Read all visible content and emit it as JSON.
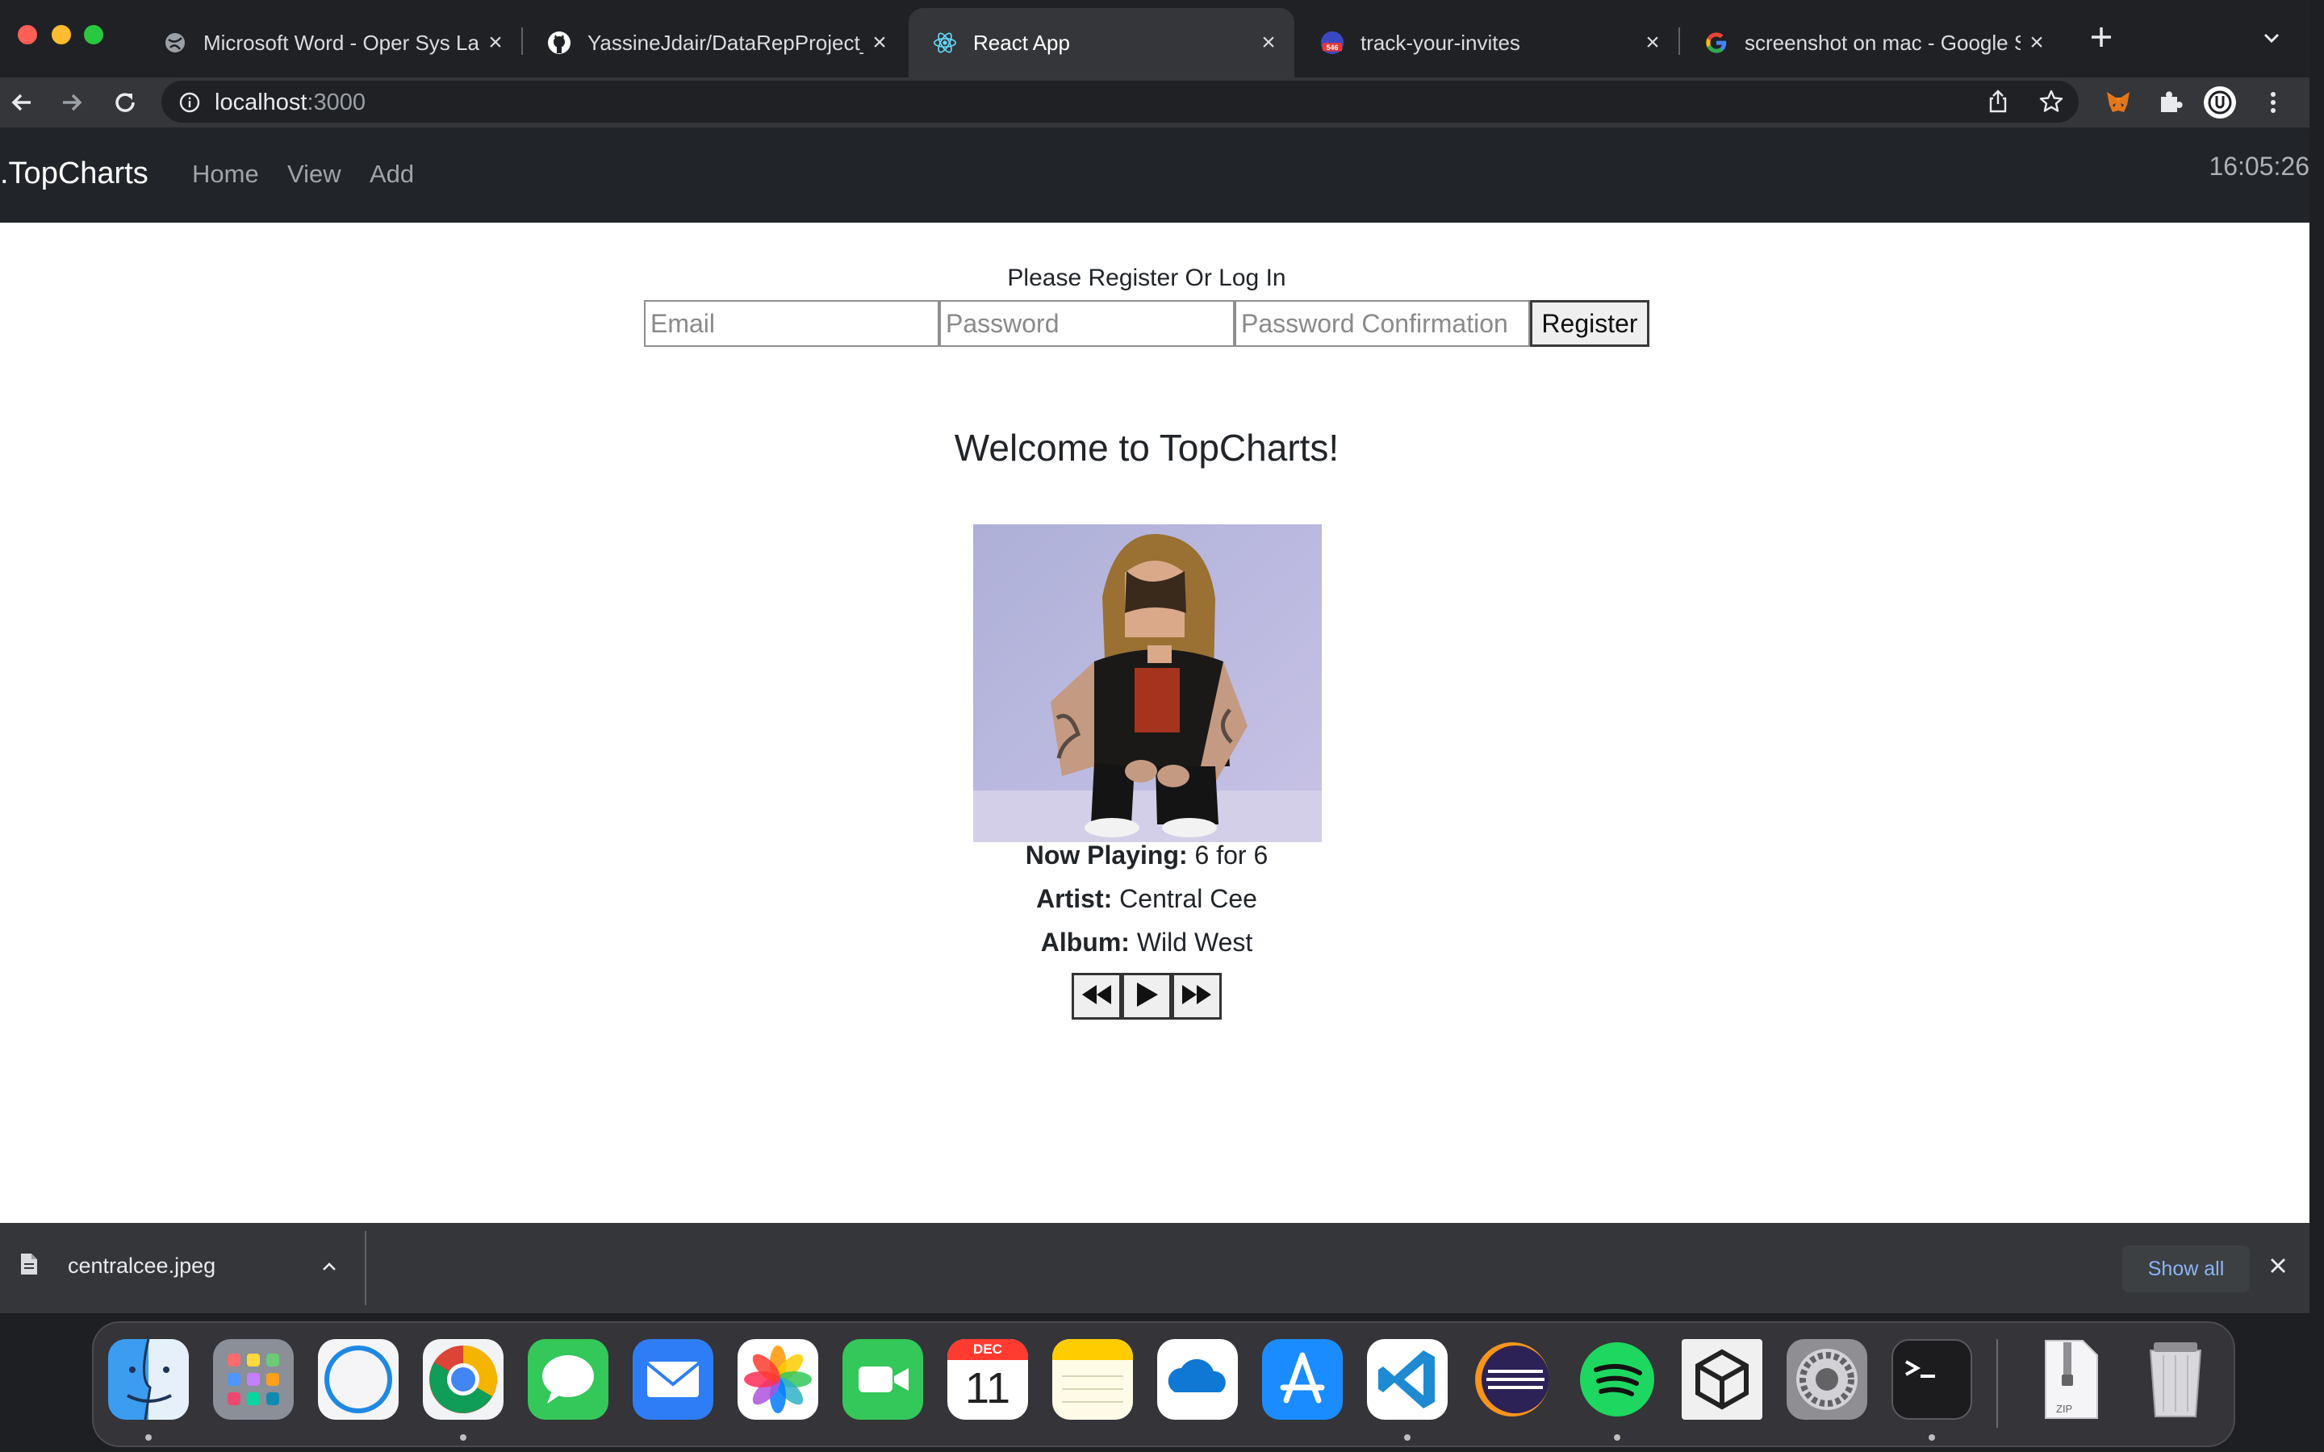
{
  "browser": {
    "tabs": [
      {
        "title": "Microsoft Word - Oper Sys Lab",
        "icon": "globe-icon",
        "active": false
      },
      {
        "title": "YassineJdair/DataRepProject_C",
        "icon": "github-icon",
        "active": false
      },
      {
        "title": "React App",
        "icon": "react-icon",
        "active": true
      },
      {
        "title": "track-your-invites",
        "icon": "counter-badge-icon",
        "badge": "546",
        "active": false
      },
      {
        "title": "screenshot on mac - Google Se",
        "icon": "google-icon",
        "active": false
      }
    ],
    "url_host": "localhost",
    "url_port": ":3000",
    "new_tab_icon": "plus-icon"
  },
  "app": {
    "brand": ".TopCharts",
    "nav": [
      "Home",
      "View",
      "Add"
    ],
    "clock": "16:05:26"
  },
  "auth": {
    "prompt": "Please Register Or Log In",
    "email_placeholder": "Email",
    "password_placeholder": "Password",
    "confirm_placeholder": "Password Confirmation",
    "register_label": "Register"
  },
  "player": {
    "welcome": "Welcome to TopCharts!",
    "now_playing_label": "Now Playing:",
    "now_playing_value": "6 for 6",
    "artist_label": "Artist:",
    "artist_value": "Central Cee",
    "album_label": "Album:",
    "album_value": "Wild West",
    "controls": [
      "rewind-icon",
      "play-icon",
      "fast-forward-icon"
    ]
  },
  "downloads": {
    "file_name": "centralcee.jpeg",
    "show_all": "Show all"
  },
  "dock": {
    "calendar_month": "DEC",
    "calendar_day": "11",
    "zip_label": "ZIP",
    "apps": [
      "finder",
      "launchpad",
      "safari",
      "chrome",
      "messages",
      "mail",
      "photos",
      "facetime",
      "calendar",
      "notes",
      "onedrive",
      "app-store",
      "vscode",
      "eclipse",
      "spotify",
      "unity",
      "system-preferences",
      "terminal",
      "zip-archive",
      "trash"
    ]
  },
  "colors": {
    "chrome_dark": "#202124",
    "toolbar": "#35363a",
    "app_navbar": "#212529",
    "show_all_text": "#8ab4f8"
  }
}
